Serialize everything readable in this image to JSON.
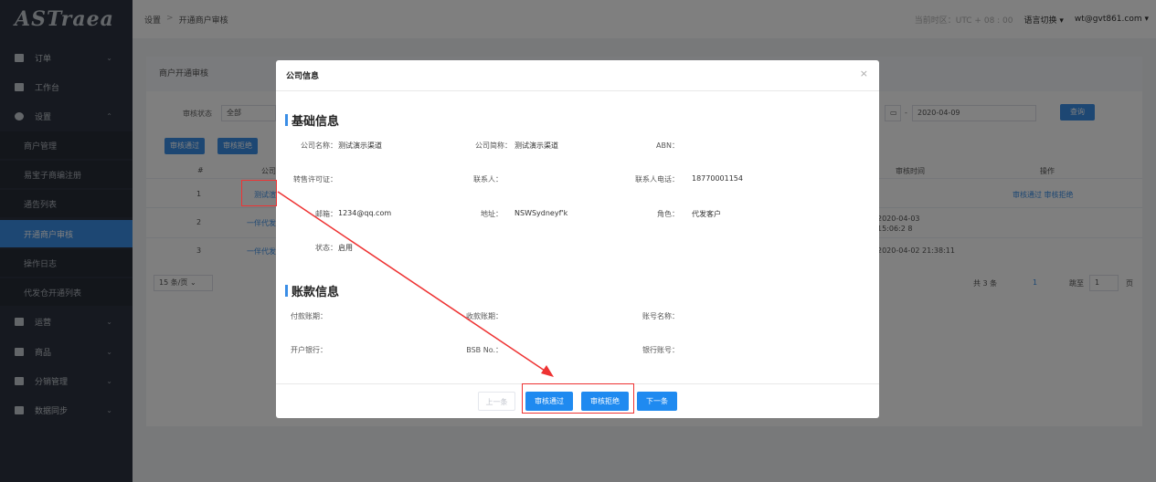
{
  "header": {
    "breadcrumb": [
      "设置",
      "开通商户审核"
    ],
    "timezone": "当前时区：UTC + 08 : 00",
    "language_label": "语言切换 ▾",
    "user": "wt@gvt861.com ▾"
  },
  "sidebar": {
    "logo": "ASTraea",
    "items": [
      {
        "label": "订单",
        "arrow": "⌄"
      },
      {
        "label": "工作台",
        "arrow": ""
      },
      {
        "label": "设置",
        "arrow": "⌃"
      },
      {
        "label": "商户管理"
      },
      {
        "label": "易宝子商编注册"
      },
      {
        "label": "通告列表"
      },
      {
        "label": "开通商户审核"
      },
      {
        "label": "操作日志"
      },
      {
        "label": "代发仓开通列表"
      },
      {
        "label": "运营",
        "arrow": "⌄"
      },
      {
        "label": "商品",
        "arrow": "⌄"
      },
      {
        "label": "分销管理",
        "arrow": "⌄"
      },
      {
        "label": "数据同步",
        "arrow": "⌄"
      }
    ]
  },
  "background": {
    "panel_title": "商户开通审核",
    "status_label": "审核状态",
    "status_value": "全部",
    "date_end": "2020-04-09",
    "date_sep": "-",
    "query_btn": "查询",
    "approve_btn": "审核通过",
    "reject_btn": "审核拒绝",
    "col_no": "#",
    "col_company": "公司",
    "col_time": "审核时间",
    "col_ops": "操作",
    "rows": [
      {
        "no": "1",
        "company": "测试渲",
        "time": "",
        "ops": "审核通过  审核拒绝"
      },
      {
        "no": "2",
        "company": "一伴代发",
        "time": "2020-04-03 15:06:2 8"
      },
      {
        "no": "3",
        "company": "一伴代发",
        "time": "2020-04-02 21:38:11"
      }
    ],
    "page_size": "15 条/页 ⌄",
    "total": "共 3 条",
    "page_current": "1",
    "jump_label": "跳至",
    "jump_value": "1",
    "page_unit": "页"
  },
  "modal": {
    "title": "公司信息",
    "close": "×",
    "basic_title": "基础信息",
    "basic_fields": [
      {
        "label": "公司名称：",
        "value": "测试演示渠道"
      },
      {
        "label": "公司简称：",
        "value": "测试演示渠道"
      },
      {
        "label": "ABN：",
        "value": ""
      },
      {
        "label": "转售许可证：",
        "value": ""
      },
      {
        "label": "联系人：",
        "value": ""
      },
      {
        "label": "联系人电话：",
        "value": "18770001154"
      },
      {
        "label": "邮箱：",
        "value": "1234@qq.com"
      },
      {
        "label": "地址：",
        "value": "NSWSydneyf'k"
      },
      {
        "label": "角色：",
        "value": "代发客户"
      },
      {
        "label": "状态：",
        "value": "启用"
      }
    ],
    "account_title": "账款信息",
    "account_fields": [
      {
        "label": "付款账期：",
        "value": ""
      },
      {
        "label": "收款账期：",
        "value": ""
      },
      {
        "label": "账号名称：",
        "value": ""
      },
      {
        "label": "开户银行：",
        "value": ""
      },
      {
        "label": "BSB No.：",
        "value": ""
      },
      {
        "label": "银行账号：",
        "value": ""
      }
    ],
    "buttons": {
      "prev": "上一条",
      "approve": "审核通过",
      "reject": "审核拒绝",
      "next": "下一条"
    }
  },
  "colors": {
    "accent": "#1f8af0",
    "sidebar": "#2c3340",
    "annotation": "#ee3333"
  }
}
